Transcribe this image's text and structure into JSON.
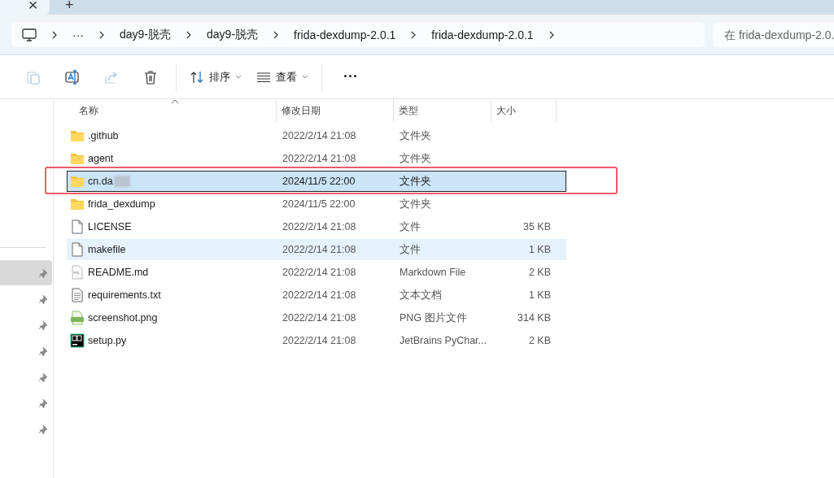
{
  "tab_strip": {
    "close": "×",
    "new_tab": "+"
  },
  "breadcrumb": {
    "more": "···",
    "items": [
      "day9-脱壳",
      "day9-脱壳",
      "frida-dexdump-2.0.1",
      "frida-dexdump-2.0.1"
    ]
  },
  "search": {
    "placeholder": "在 frida-dexdump-2.0."
  },
  "toolbar": {
    "sort": "排序",
    "view": "查看",
    "more": "···"
  },
  "sidebar": {
    "items": [
      {
        "selected": true
      },
      {
        "selected": false
      },
      {
        "selected": false
      },
      {
        "selected": false
      },
      {
        "selected": false
      },
      {
        "selected": false
      },
      {
        "selected": false
      }
    ]
  },
  "table": {
    "columns": [
      "名称",
      "修改日期",
      "类型",
      "大小"
    ],
    "rows": [
      {
        "kind": "folder",
        "name": "github",
        "name_prefix": ".",
        "date": "2022/2/14 21:08",
        "type": "文件夹",
        "size": "",
        "selected": false,
        "hovered": false,
        "redacted": false
      },
      {
        "kind": "folder",
        "name": "agent",
        "date": "2022/2/14 21:08",
        "type": "文件夹",
        "size": "",
        "selected": false,
        "hovered": false,
        "redacted": false
      },
      {
        "kind": "folder",
        "name": "cn.da",
        "date": "2024/11/5 22:00",
        "type": "文件夹",
        "size": "",
        "selected": true,
        "hovered": false,
        "redacted": true,
        "annotated": true
      },
      {
        "kind": "folder",
        "name": "frida_dexdump",
        "date": "2024/11/5 22:00",
        "type": "文件夹",
        "size": "",
        "selected": false,
        "hovered": false,
        "redacted": false
      },
      {
        "kind": "file",
        "name": "LICENSE",
        "date": "2022/2/14 21:08",
        "type": "文件",
        "size": "35 KB",
        "selected": false,
        "hovered": false,
        "redacted": false
      },
      {
        "kind": "file",
        "name": "makefile",
        "date": "2022/2/14 21:08",
        "type": "文件",
        "size": "1 KB",
        "selected": false,
        "hovered": true,
        "redacted": false
      },
      {
        "kind": "markdown",
        "name": "README.md",
        "date": "2022/2/14 21:08",
        "type": "Markdown File",
        "size": "2 KB",
        "selected": false,
        "hovered": false,
        "redacted": false
      },
      {
        "kind": "text",
        "name": "requirements.txt",
        "date": "2022/2/14 21:08",
        "type": "文本文档",
        "size": "1 KB",
        "selected": false,
        "hovered": false,
        "redacted": false
      },
      {
        "kind": "image",
        "name": "screenshot.png",
        "date": "2022/2/14 21:08",
        "type": "PNG 图片文件",
        "size": "314 KB",
        "selected": false,
        "hovered": false,
        "redacted": false
      },
      {
        "kind": "pycharm",
        "name": "setup.py",
        "date": "2022/2/14 21:08",
        "type": "JetBrains PyChar...",
        "size": "2 KB",
        "selected": false,
        "hovered": false,
        "redacted": false
      }
    ]
  }
}
